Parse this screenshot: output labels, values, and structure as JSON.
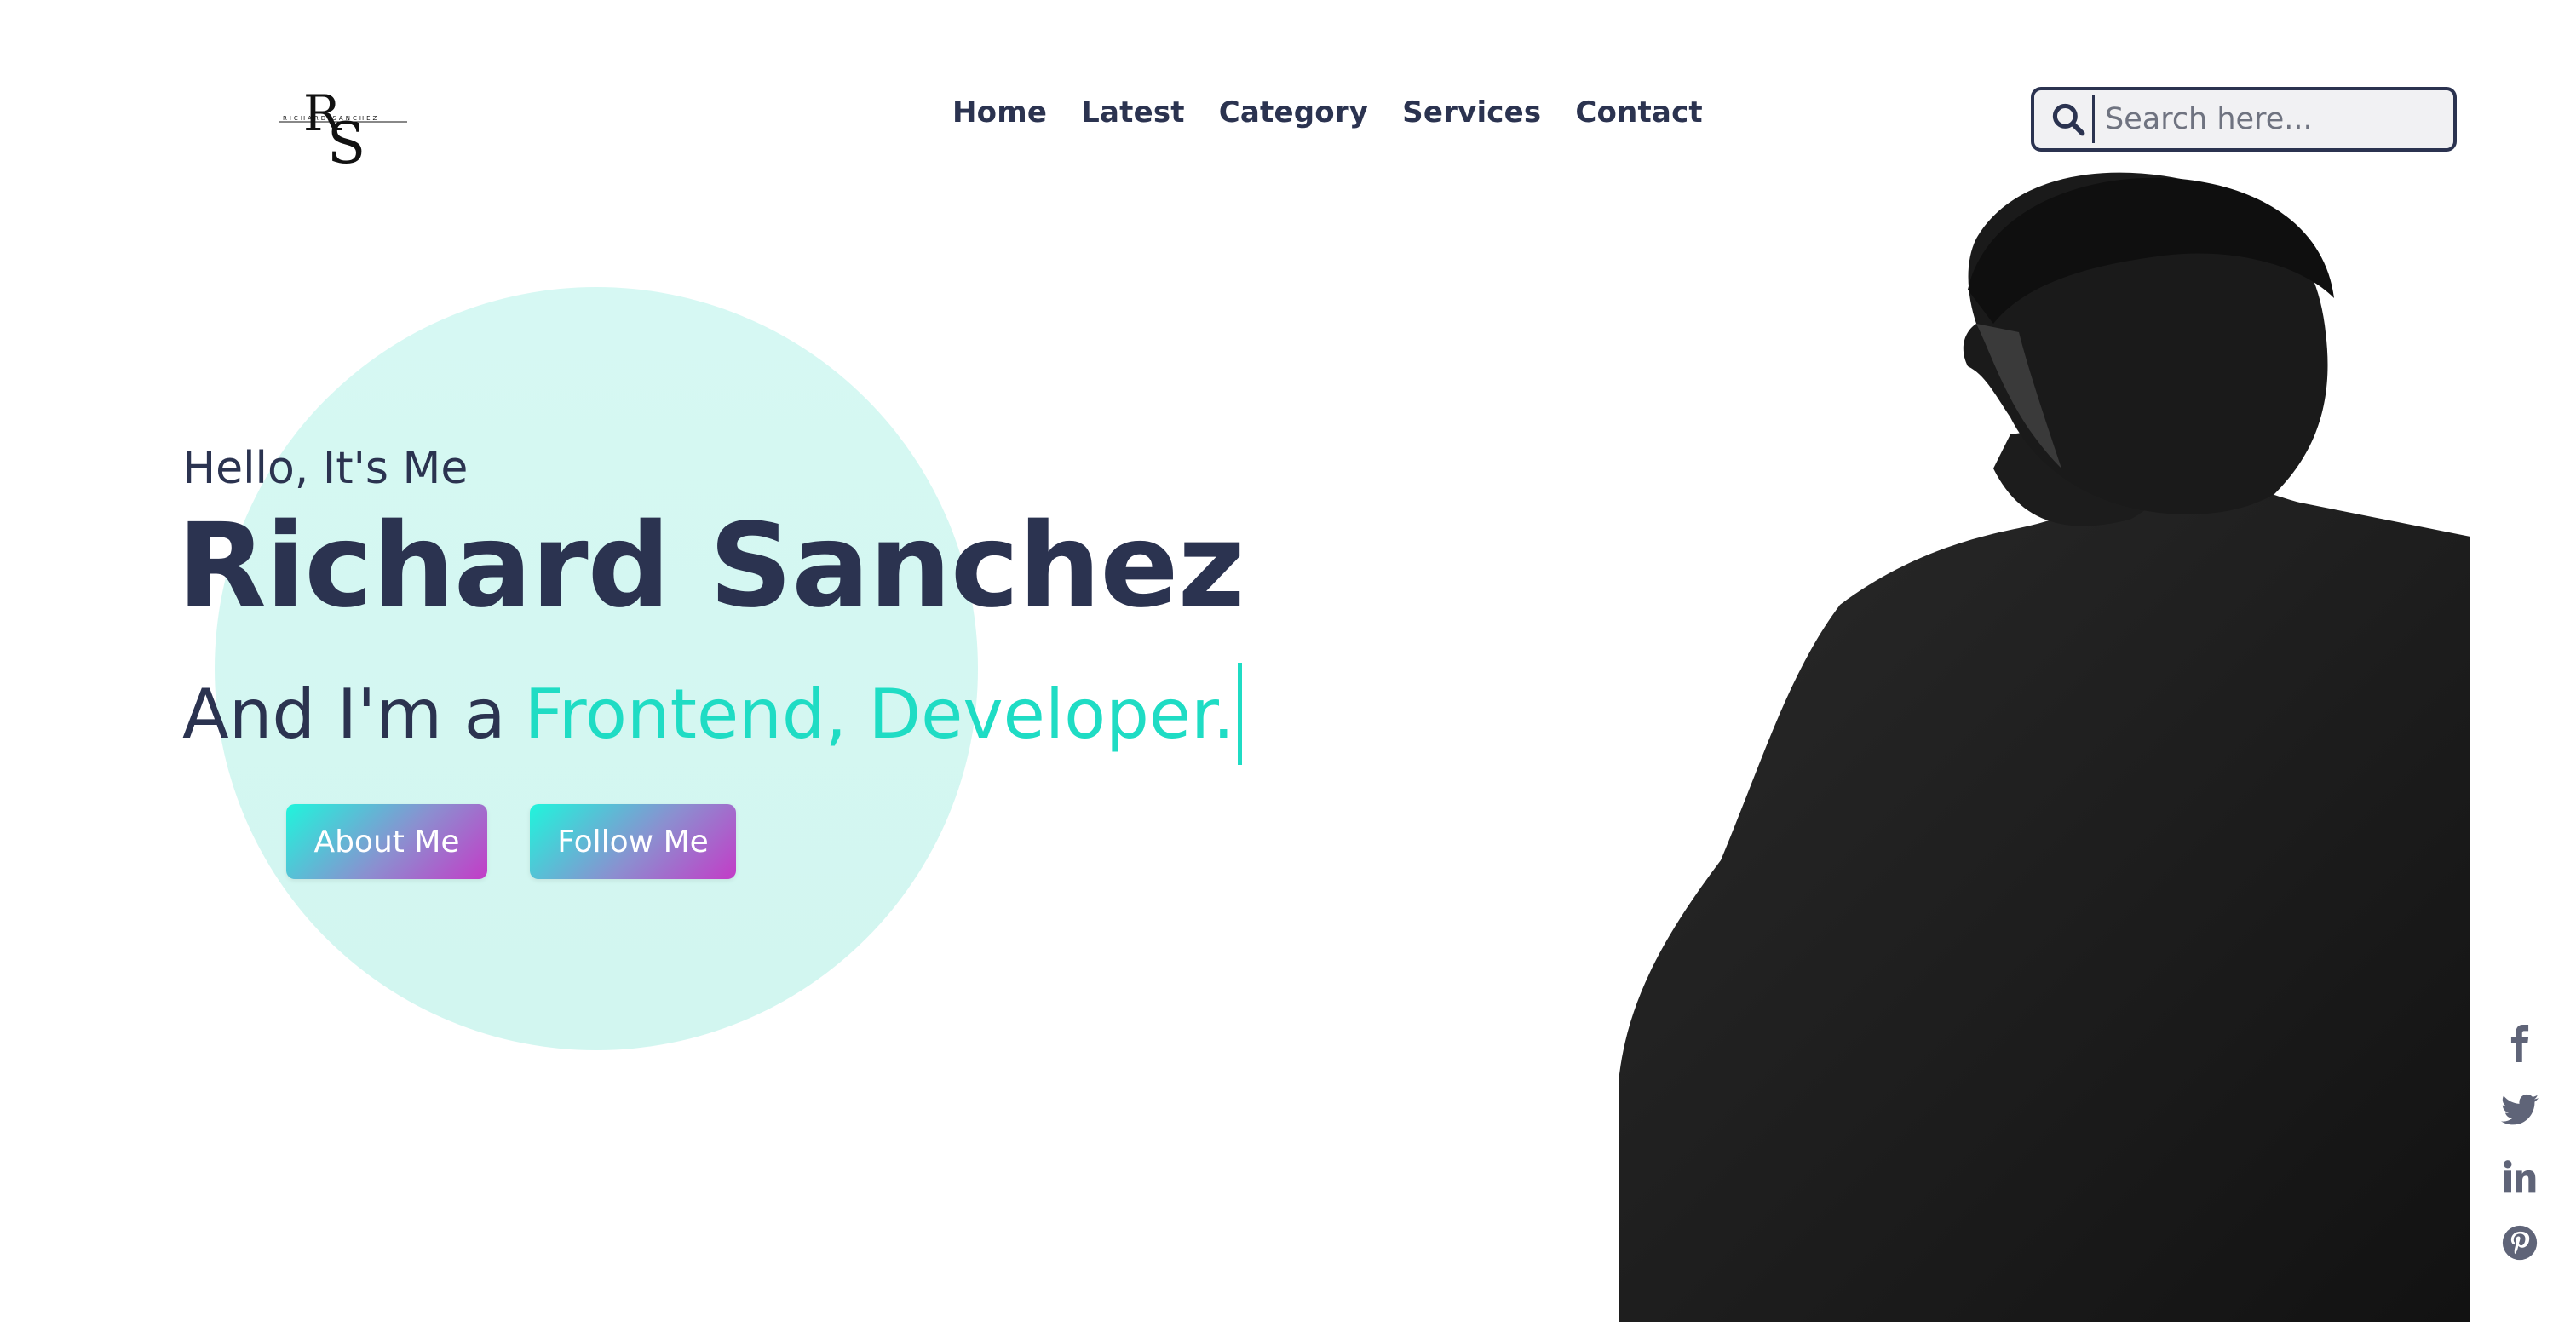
{
  "header": {
    "logo_text": "RS",
    "logo_subtext": "RICHARD SANCHEZ",
    "nav": [
      {
        "label": "Home"
      },
      {
        "label": "Latest"
      },
      {
        "label": "Category"
      },
      {
        "label": "Services"
      },
      {
        "label": "Contact"
      }
    ],
    "search": {
      "placeholder": "Search here...",
      "value": "",
      "icon": "search-icon"
    }
  },
  "hero": {
    "greeting": "Hello, It's Me",
    "name": "Richard Sanchez",
    "role_prefix": "And I'm a",
    "role_typed": "Frontend, Developer.",
    "buttons": [
      {
        "label": "About Me"
      },
      {
        "label": "Follow Me"
      }
    ]
  },
  "social": [
    {
      "icon": "facebook-icon"
    },
    {
      "icon": "twitter-icon"
    },
    {
      "icon": "linkedin-icon"
    },
    {
      "icon": "pinterest-icon"
    }
  ],
  "colors": {
    "text_dark": "#2b3350",
    "accent": "#1fdcc4",
    "circle": "#d6f8f3",
    "button_gradient_start": "#1ff5dc",
    "button_gradient_end": "#c33cc7",
    "social_icon": "#5f6478"
  }
}
